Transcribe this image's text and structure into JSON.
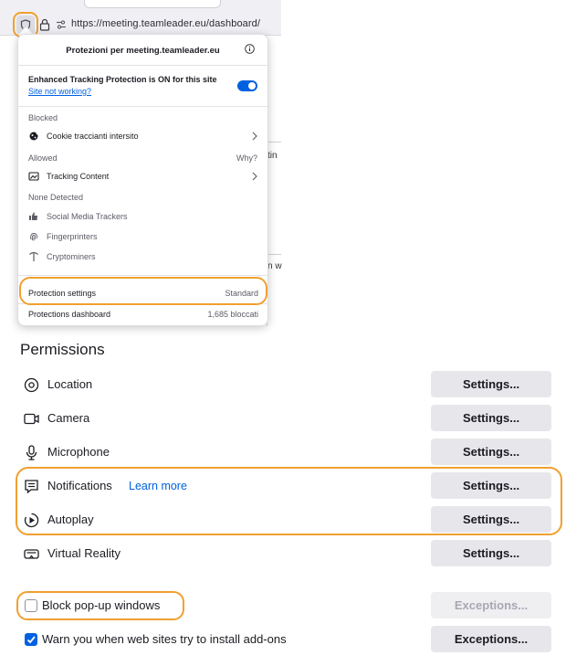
{
  "colors": {
    "accent": "#0061e0",
    "highlight": "#f0a030",
    "button_bg": "#e7e7eb"
  },
  "urlbar": {
    "url": "https://meeting.teamleader.eu/dashboard/"
  },
  "panel": {
    "title": "Protezioni per meeting.teamleader.eu",
    "etp_status": "Enhanced Tracking Protection is ON for this site",
    "site_not_working": "Site not working?",
    "toggle_on": true,
    "blocked_label": "Blocked",
    "blocked_items": [
      {
        "label": "Cookie traccianti intersito",
        "icon": "cookie-icon"
      }
    ],
    "allowed_label": "Allowed",
    "why_label": "Why?",
    "allowed_items": [
      {
        "label": "Tracking Content",
        "icon": "tracking-content-icon"
      }
    ],
    "none_detected_label": "None Detected",
    "none_items": [
      {
        "label": "Social Media Trackers",
        "icon": "thumbs-icon"
      },
      {
        "label": "Fingerprinters",
        "icon": "fingerprint-icon"
      },
      {
        "label": "Cryptominers",
        "icon": "pickaxe-icon"
      }
    ],
    "protection_settings": {
      "label": "Protection settings",
      "value": "Standard"
    },
    "protections_dashboard": {
      "label": "Protections dashboard",
      "value": "1,685 bloccati"
    }
  },
  "background_fragments": [
    "tin",
    "n w"
  ],
  "permissions": {
    "title": "Permissions",
    "rows": [
      {
        "label": "Location",
        "icon": "location-icon",
        "button": "Settings..."
      },
      {
        "label": "Camera",
        "icon": "camera-icon",
        "button": "Settings..."
      },
      {
        "label": "Microphone",
        "icon": "microphone-icon",
        "button": "Settings..."
      },
      {
        "label": "Notifications",
        "icon": "notification-icon",
        "button": "Settings...",
        "link": "Learn more"
      },
      {
        "label": "Autoplay",
        "icon": "autoplay-icon",
        "button": "Settings..."
      },
      {
        "label": "Virtual Reality",
        "icon": "vr-headset-icon",
        "button": "Settings..."
      }
    ],
    "block_popups": {
      "label": "Block pop-up windows",
      "checked": false,
      "button": "Exceptions...",
      "button_disabled": true
    },
    "warn_addons": {
      "label": "Warn you when web sites try to install add-ons",
      "checked": true,
      "button": "Exceptions..."
    }
  }
}
